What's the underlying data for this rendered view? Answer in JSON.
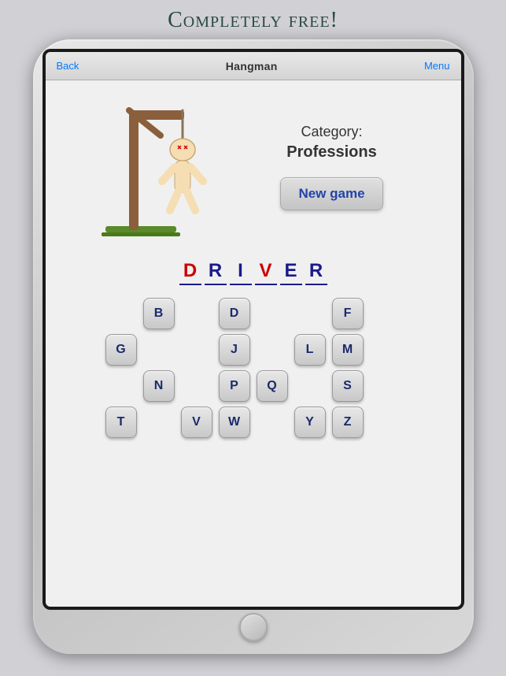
{
  "page": {
    "title": "Completely free!"
  },
  "navbar": {
    "back_label": "Back",
    "title": "Hangman",
    "menu_label": "Menu"
  },
  "game": {
    "category_label": "Category:",
    "category_value": "Professions",
    "new_game_label": "New game"
  },
  "word": {
    "letters": [
      {
        "char": "D",
        "status": "wrong"
      },
      {
        "char": "R",
        "status": "normal"
      },
      {
        "char": "I",
        "status": "normal"
      },
      {
        "char": "V",
        "status": "wrong"
      },
      {
        "char": "E",
        "status": "normal"
      },
      {
        "char": "R",
        "status": "normal"
      }
    ]
  },
  "keyboard": {
    "rows": [
      [
        "",
        "B",
        "",
        "D",
        "",
        "",
        "F",
        ""
      ],
      [
        "G",
        "",
        "",
        "J",
        "",
        "L",
        "M",
        ""
      ],
      [
        "",
        "N",
        "",
        "P",
        "Q",
        "",
        "S",
        ""
      ],
      [
        "T",
        "",
        "V",
        "W",
        "",
        "Y",
        "Z",
        ""
      ]
    ]
  },
  "colors": {
    "wrong_letter": "#cc0000",
    "normal_letter": "#1a1a8c",
    "button_text": "#2244aa"
  }
}
